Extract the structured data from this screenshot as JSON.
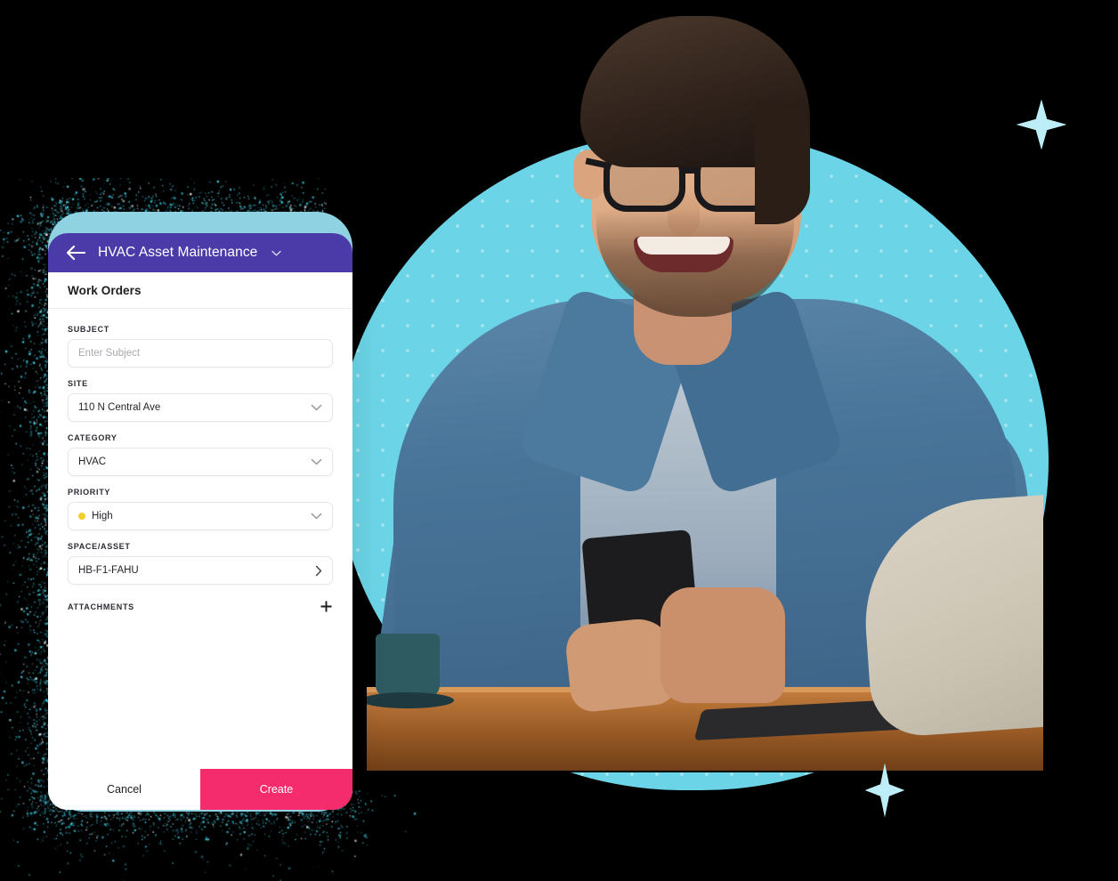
{
  "app": {
    "header": {
      "back_icon": "arrow-left-icon",
      "title": "HVAC Asset Maintenance",
      "caret_icon": "chevron-down-icon",
      "background_color": "#4B3BA8"
    },
    "subheader": {
      "title": "Work Orders"
    },
    "form": {
      "fields": [
        {
          "label": "SUBJECT",
          "type": "text",
          "value": "",
          "placeholder": "Enter Subject"
        },
        {
          "label": "SITE",
          "type": "select",
          "value": "110 N Central Ave",
          "icon": "chevron-down-icon"
        },
        {
          "label": "CATEGORY",
          "type": "select",
          "value": "HVAC",
          "icon": "chevron-down-icon"
        },
        {
          "label": "PRIORITY",
          "type": "select",
          "value": "High",
          "dot_color": "#F0CF2E",
          "icon": "chevron-down-icon"
        },
        {
          "label": "SPACE/ASSET",
          "type": "navigation",
          "value": "HB-F1-FAHU",
          "icon": "chevron-right-icon"
        }
      ],
      "attachments": {
        "label": "ATTACHMENTS",
        "add_icon": "plus-icon"
      }
    },
    "actions": {
      "cancel_label": "Cancel",
      "create_label": "Create",
      "create_color": "#F42C6E"
    }
  },
  "decor": {
    "blob_color": "#6BD4E6",
    "phone_frame_color": "#8FD3E3",
    "sparkle_color": "#BDEEF7",
    "background_color": "#000000",
    "sparkles": [
      "sparkle-icon",
      "sparkle-icon"
    ]
  },
  "photo": {
    "alt": "smiling-man-with-glasses-using-phone-at-laptop"
  }
}
